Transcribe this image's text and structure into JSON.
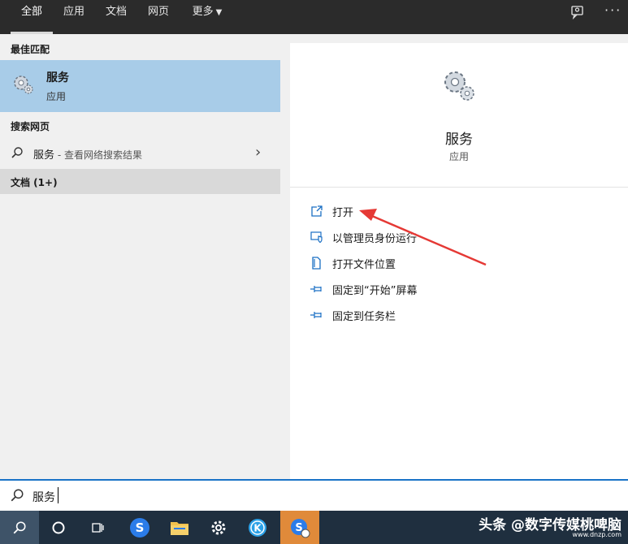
{
  "tabs": [
    "全部",
    "应用",
    "文档",
    "网页",
    "更多"
  ],
  "left": {
    "best_match_header": "最佳匹配",
    "best_match": {
      "name": "服务",
      "type": "应用"
    },
    "web_header": "搜索网页",
    "web_result": {
      "query": "服务",
      "suffix": " - 查看网络搜索结果"
    },
    "docs_header": "文档 (1+)"
  },
  "right": {
    "name": "服务",
    "type": "应用",
    "actions": [
      "打开",
      "以管理员身份运行",
      "打开文件位置",
      "固定到“开始”屏幕",
      "固定到任务栏"
    ]
  },
  "search": {
    "value": "服务"
  },
  "watermark": {
    "main": "头条 @数字传媒桃啤脑",
    "url": "www.dnzp.com"
  },
  "colors": {
    "accent": "#1a73c7",
    "selected": "#a8cce8",
    "topbar": "#2b2b2b",
    "taskbar": "#1f2f3f",
    "arrow": "#e53935"
  }
}
